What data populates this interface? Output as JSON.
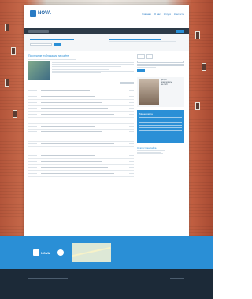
{
  "header": {
    "logo_text": "NOVA",
    "nav": [
      "Главная",
      "О нас",
      "Услуги",
      "Контакты"
    ]
  },
  "left": {
    "section_title": "Последние публикации на сайте",
    "list_rows": 15
  },
  "right": {
    "profile_lines": [
      "Добро",
      "пожаловать",
      "на сайт"
    ],
    "menu_title": "Меню сайта",
    "stats_title": "Статистика сайта"
  },
  "footer": {
    "logo_text": "NOVA"
  },
  "colors": {
    "accent": "#2a8fd6",
    "dark": "#1c2a38",
    "footer": "#2a8fd6"
  }
}
